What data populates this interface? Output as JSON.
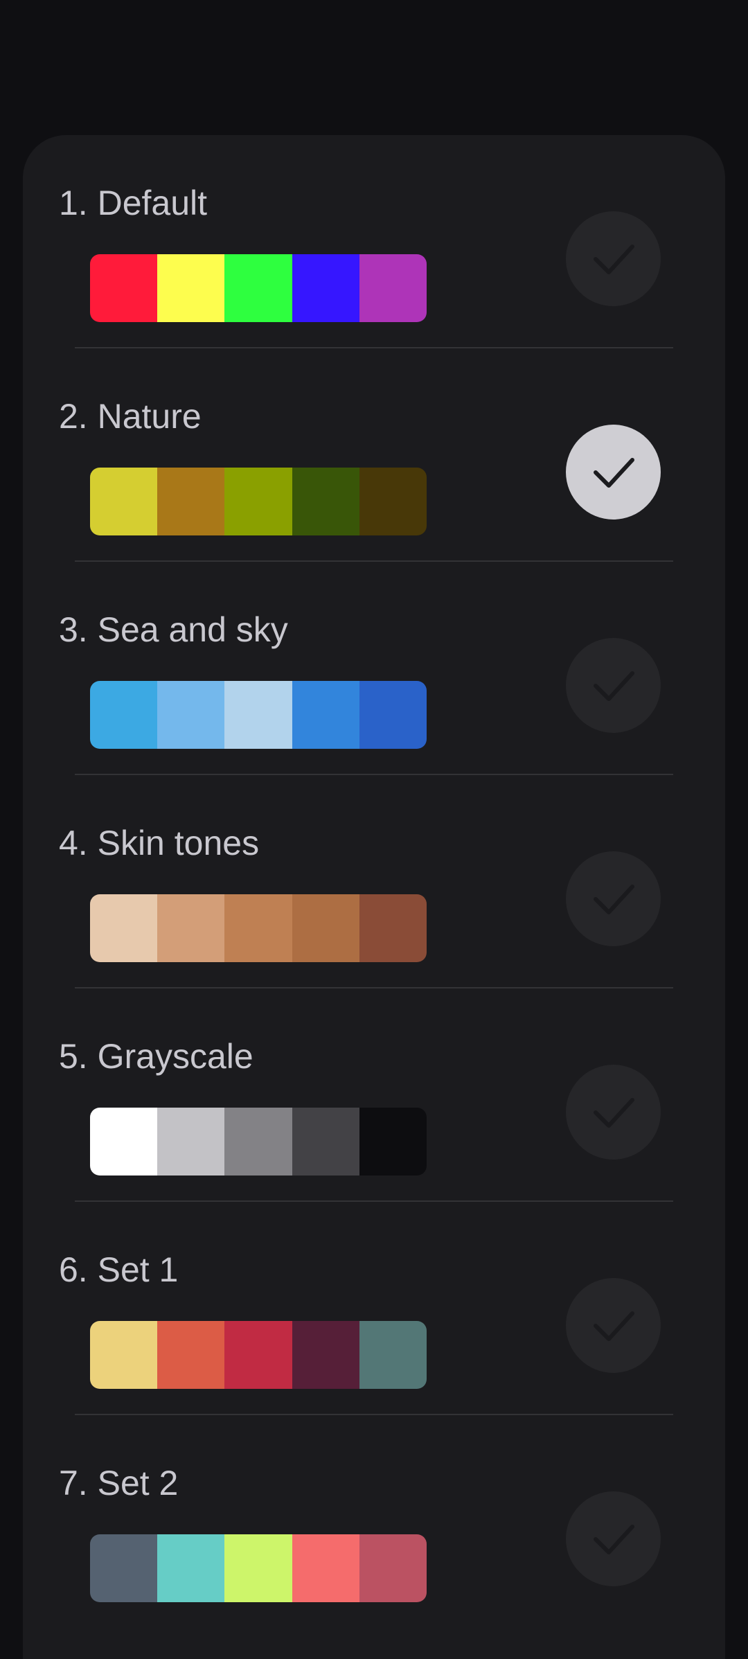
{
  "palettes": [
    {
      "label": "1. Default",
      "colors": [
        "#ff1b3a",
        "#fdfd4e",
        "#2eff3f",
        "#3616ff",
        "#ae34b8"
      ],
      "selected": false
    },
    {
      "label": "2. Nature",
      "colors": [
        "#d5ce31",
        "#a97818",
        "#8aa000",
        "#395608",
        "#483808"
      ],
      "selected": true
    },
    {
      "label": "3. Sea and sky",
      "colors": [
        "#3ca9e3",
        "#74b8ec",
        "#b2d3ec",
        "#3285dc",
        "#2a62c9"
      ],
      "selected": false
    },
    {
      "label": "4. Skin tones",
      "colors": [
        "#e7c9ad",
        "#d39e78",
        "#bf8053",
        "#ad6e43",
        "#8a4c37"
      ],
      "selected": false
    },
    {
      "label": "5. Grayscale",
      "colors": [
        "#ffffff",
        "#c3c2c6",
        "#838286",
        "#434246",
        "#0d0d10"
      ],
      "selected": false
    },
    {
      "label": "6. Set 1",
      "colors": [
        "#ecd27c",
        "#dc5c46",
        "#c12b43",
        "#561f38",
        "#537776"
      ],
      "selected": false
    },
    {
      "label": "7. Set 2",
      "colors": [
        "#556271",
        "#66cdc6",
        "#cdf56a",
        "#f56c6c",
        "#bb5262"
      ],
      "selected": false
    }
  ],
  "colors": {
    "background": "#0f0f12",
    "card": "#1b1b1e",
    "text": "#c9c8cf",
    "check_idle_bg": "#262629",
    "check_idle_mark": "#1a1a1d",
    "check_selected_bg": "#cfced3",
    "check_selected_mark": "#1b1b1e"
  },
  "icons": {
    "check": "checkmark-icon"
  }
}
